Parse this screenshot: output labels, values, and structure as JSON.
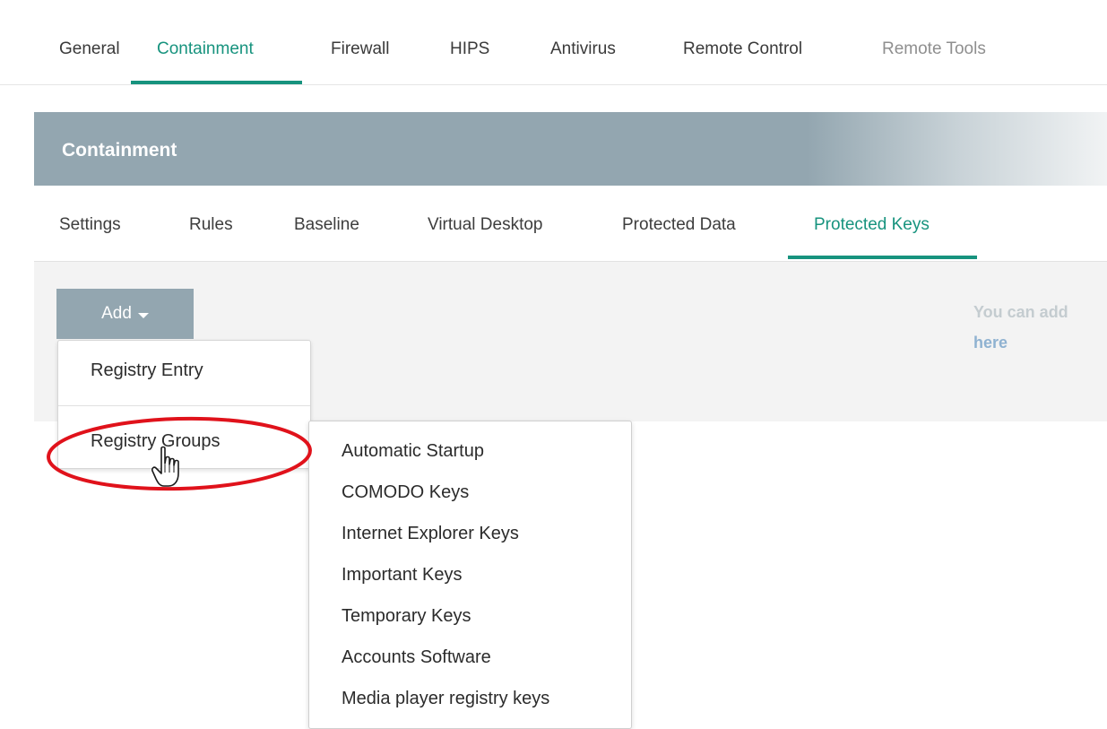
{
  "top_tabs": [
    {
      "label": "General",
      "state": "normal"
    },
    {
      "label": "Containment",
      "state": "active"
    },
    {
      "label": "Firewall",
      "state": "normal"
    },
    {
      "label": "HIPS",
      "state": "normal"
    },
    {
      "label": "Antivirus",
      "state": "normal"
    },
    {
      "label": "Remote Control",
      "state": "normal"
    },
    {
      "label": "Remote Tools",
      "state": "disabled"
    }
  ],
  "panel": {
    "title": "Containment",
    "sub_tabs": [
      {
        "label": "Settings",
        "state": "normal"
      },
      {
        "label": "Rules",
        "state": "normal"
      },
      {
        "label": "Baseline",
        "state": "normal"
      },
      {
        "label": "Virtual Desktop",
        "state": "normal"
      },
      {
        "label": "Protected Data",
        "state": "normal"
      },
      {
        "label": "Protected Keys",
        "state": "active"
      }
    ],
    "add_button_label": "Add",
    "info_text": "You can add",
    "info_link": "here"
  },
  "add_menu": {
    "items": [
      "Registry Entry",
      "Registry Groups"
    ],
    "highlighted_item": "Registry Groups"
  },
  "registry_groups_submenu": {
    "items": [
      "Automatic Startup",
      "COMODO Keys",
      "Internet Explorer Keys",
      "Important Keys",
      "Temporary Keys",
      "Accounts Software",
      "Media player registry keys"
    ]
  },
  "colors": {
    "accent": "#17937e",
    "header_bg": "#93a6b0",
    "highlight_circle": "#e0121b"
  },
  "icons": {
    "add_caret": "caret-down-icon",
    "pointer": "hand-pointer-cursor-icon"
  }
}
